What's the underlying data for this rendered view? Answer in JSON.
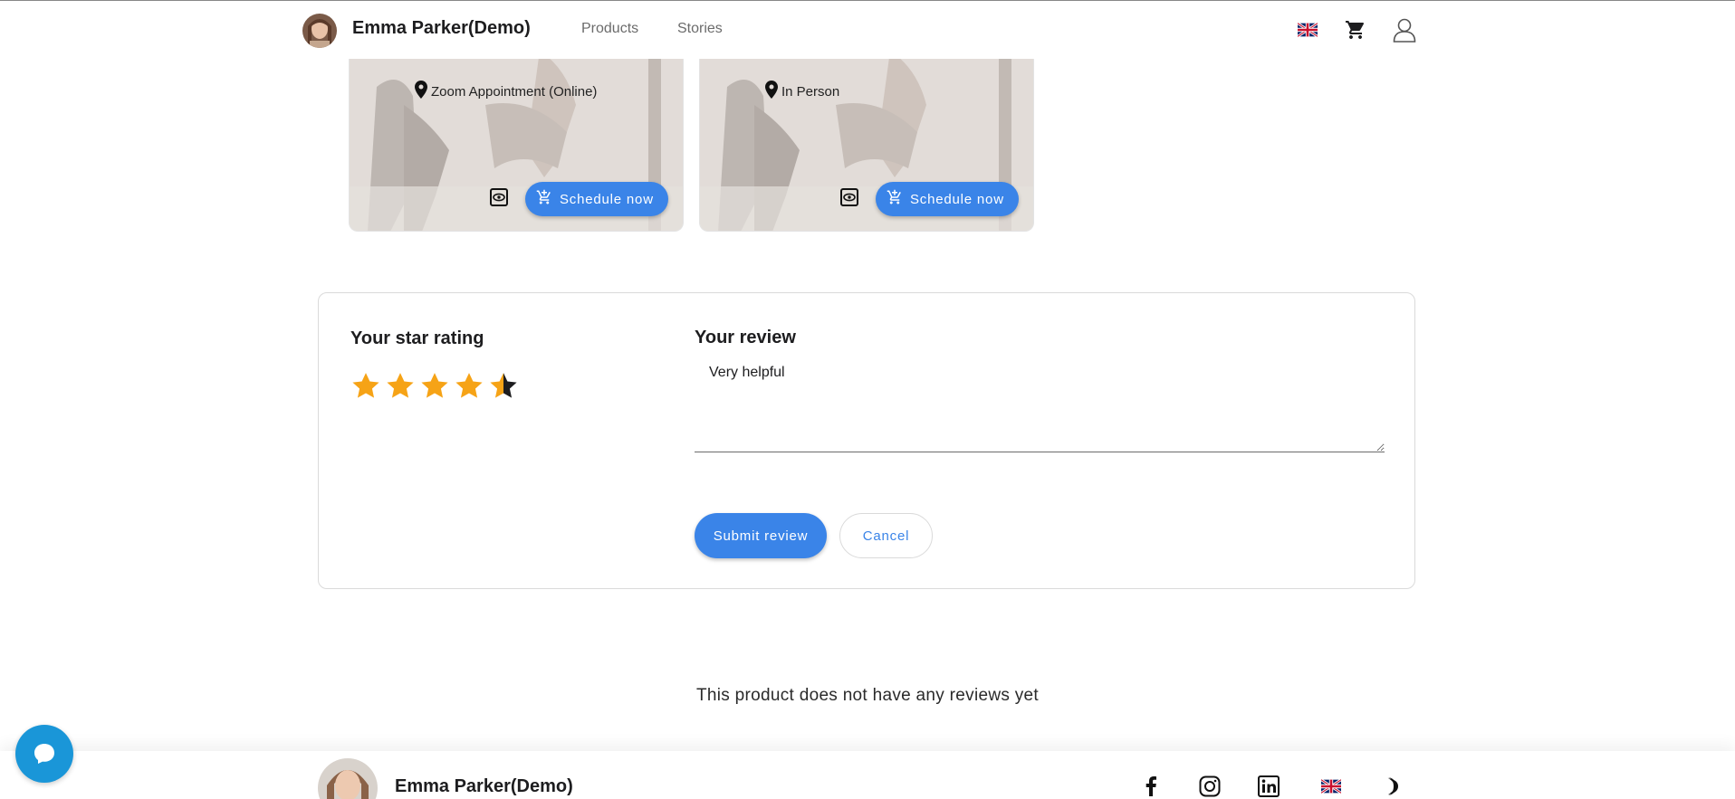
{
  "header": {
    "brand_name": "Emma Parker(Demo)",
    "nav": [
      {
        "label": "Products"
      },
      {
        "label": "Stories"
      }
    ],
    "icons": [
      "uk-flag-icon",
      "cart-icon",
      "user-icon"
    ]
  },
  "cards": [
    {
      "location": "Zoom Appointment (Online)",
      "button_label": "Schedule now"
    },
    {
      "location": "In Person",
      "button_label": "Schedule now"
    }
  ],
  "review_form": {
    "rating_heading": "Your star rating",
    "rating_value": 4.5,
    "rating_max": 5,
    "review_heading": "Your review",
    "review_text": "Very helpful",
    "submit_label": "Submit review",
    "cancel_label": "Cancel"
  },
  "empty_state": "This product does not have any reviews yet",
  "footer": {
    "brand_name": "Emma Parker(Demo)",
    "icons": [
      "facebook-icon",
      "instagram-icon",
      "linkedin-icon",
      "uk-flag-icon",
      "dark-mode-icon"
    ]
  },
  "colors": {
    "accent": "#3a84e8",
    "star": "#f6a316",
    "chat": "#1a96d8"
  }
}
